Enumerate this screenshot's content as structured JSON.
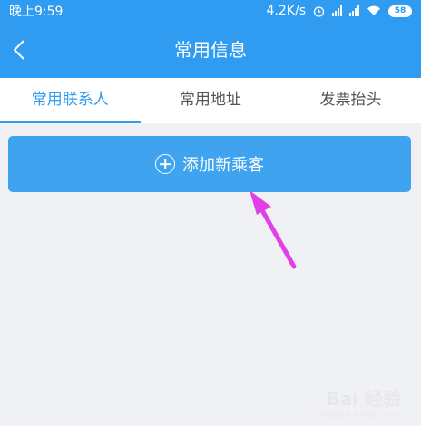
{
  "status_bar": {
    "time": "晚上9:59",
    "speed": "4.2K/s",
    "battery": "58"
  },
  "header": {
    "title": "常用信息",
    "back_icon": "chevron-left-icon"
  },
  "tabs": [
    {
      "label": "常用联系人",
      "active": true
    },
    {
      "label": "常用地址",
      "active": false
    },
    {
      "label": "发票抬头",
      "active": false
    }
  ],
  "add_button": {
    "label": "添加新乘客",
    "icon": "plus-circle-icon"
  },
  "watermark": {
    "text": "Bai 经验",
    "sub": "jingyan.baidu.com"
  },
  "colors": {
    "primary": "#2f9bf1",
    "button": "#3fa3ef",
    "annotation_arrow": "#e040e6",
    "background": "#f0f1f5"
  }
}
